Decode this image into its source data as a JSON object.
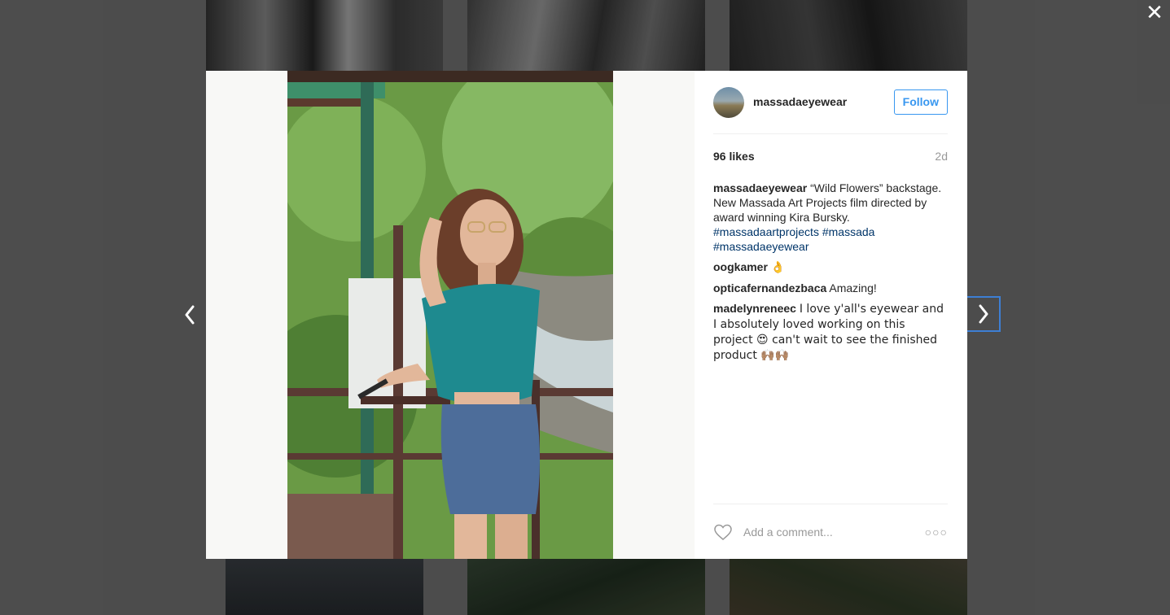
{
  "post": {
    "username": "massadaeyewear",
    "follow_label": "Follow",
    "likes": "96 likes",
    "time": "2d"
  },
  "caption": {
    "author": "massadaeyewear",
    "text": "“Wild Flowers” backstage. New Massada Art Projects film directed by award winning Kira Bursky.",
    "hashtags": [
      "#massadaartprojects",
      "#massada",
      "#massadaeyewear"
    ]
  },
  "comments": [
    {
      "author": "oogkamer",
      "text": "👌"
    },
    {
      "author": "opticafernandezbaca",
      "text": "Amazing!"
    },
    {
      "author": "madelynreneec",
      "text": "I love y'all's eyewear and I absolutely loved working on this project 😍 can't wait to see the finished product 🙌🏽🙌🏽"
    }
  ],
  "footer": {
    "comment_placeholder": "Add a comment...",
    "more_label": "○○○"
  },
  "controls": {
    "close_label": "✕"
  },
  "icons": {
    "close": "close-icon",
    "prev": "chevron-left-icon",
    "next": "chevron-right-icon",
    "like": "heart-icon",
    "more": "more-options-icon"
  }
}
